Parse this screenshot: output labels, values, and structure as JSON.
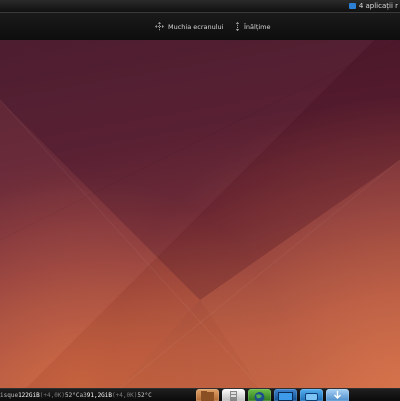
{
  "top_bar": {
    "notice_text": "4 aplicații r"
  },
  "toolbar": {
    "edge_label": "Muchia ecranului",
    "height_label": "Înălțime"
  },
  "bottom_panel": {
    "disks": [
      {
        "label": "isque",
        "size": "122GiB",
        "io": "(+4,0K)",
        "temp": "52°C"
      },
      {
        "label": "a3",
        "size": "91,2GiB",
        "io": "(+4,0K)",
        "temp": "52°C"
      }
    ],
    "dock_apps": [
      {
        "name": "files",
        "icon": "folder-icon",
        "color": "#c8854a"
      },
      {
        "name": "archive",
        "icon": "archive-icon",
        "color": "#e8e8e8"
      },
      {
        "name": "network",
        "icon": "globe-icon",
        "color": "#3f8f2e"
      },
      {
        "name": "desktop",
        "icon": "monitor-icon",
        "color": "#1e6fb8"
      },
      {
        "name": "display",
        "icon": "display-icon",
        "color": "#2b8ed8"
      },
      {
        "name": "install",
        "icon": "installer-icon",
        "color": "#6aa8e0"
      }
    ]
  }
}
